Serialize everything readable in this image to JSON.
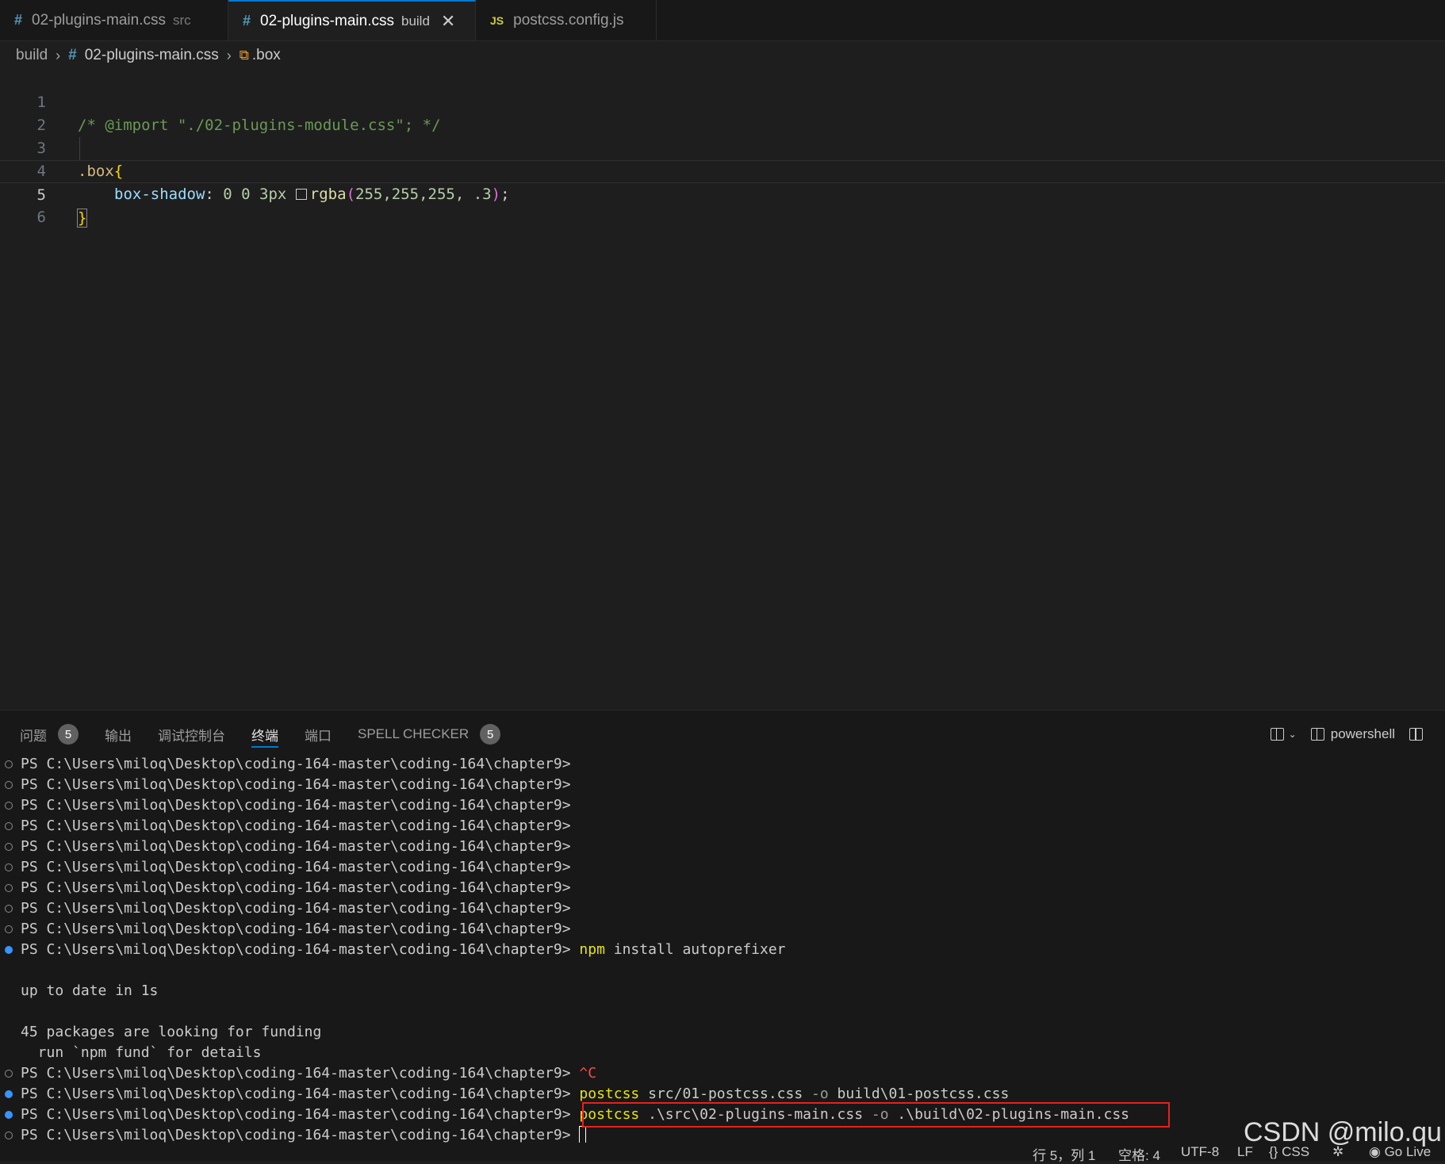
{
  "tabs": [
    {
      "icon": "#",
      "label": "02-plugins-main.css",
      "desc": "src",
      "active": false
    },
    {
      "icon": "#",
      "label": "02-plugins-main.css",
      "desc": "build",
      "active": true,
      "close": "✕"
    },
    {
      "icon": "JS",
      "label": "postcss.config.js",
      "desc": "",
      "active": false
    }
  ],
  "breadcrumb": {
    "folder": "build",
    "file": "02-plugins-main.css",
    "symbol": ".box"
  },
  "editor": {
    "line_numbers": [
      "1",
      "2",
      "3",
      "4",
      "5",
      "6"
    ],
    "line1": "/* @import \"./02-plugins-module.css\"; */",
    "line3_selector": ".box",
    "line3_brace": "{",
    "line4_prop": "box-shadow",
    "line4_colon": ": ",
    "line4_nums": "0 0 3px ",
    "line4_fn": "rgba",
    "line4_open": "(",
    "line4_args": "255,255,255, .3",
    "line4_close": ")",
    "line4_end": ";",
    "line5_brace": "}"
  },
  "panel": {
    "tabs": [
      {
        "label": "问题",
        "badge": "5"
      },
      {
        "label": "输出"
      },
      {
        "label": "调试控制台"
      },
      {
        "label": "终端",
        "active": true
      },
      {
        "label": "端口"
      },
      {
        "label": "SPELL CHECKER",
        "badge": "5"
      }
    ],
    "shell": "powershell"
  },
  "terminal": {
    "prompt": "PS C:\\Users\\miloq\\Desktop\\coding-164-master\\coding-164\\chapter9>",
    "cmd_npm": "npm",
    "cmd_npm_args": " install autoprefixer",
    "up_to_date": "up to date in 1s",
    "funding": "45 packages are looking for funding",
    "fund_hint": "  run `npm fund` for details",
    "ctrl_c": "^C",
    "cmd_postcss": "postcss",
    "postcss1_a": " src/01-postcss.css ",
    "postcss1_flag": "-o",
    "postcss1_b": " build\\01-postcss.css",
    "postcss2_a": " .\\src\\02-plugins-main.css ",
    "postcss2_flag": "-o",
    "postcss2_b": " .\\build\\02-plugins-main.css"
  },
  "status": {
    "position": "行 5，列 1",
    "spaces": "空格: 4",
    "encoding": "UTF-8",
    "eol": "LF",
    "language": "CSS",
    "golive": "Go Live"
  },
  "watermark": "CSDN @milo.qu"
}
